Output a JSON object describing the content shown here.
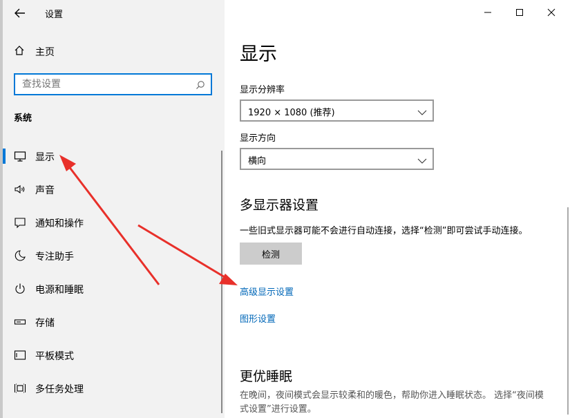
{
  "window": {
    "title": "设置"
  },
  "sidebar": {
    "home_label": "主页",
    "search_placeholder": "查找设置",
    "section_title": "系统",
    "items": [
      {
        "label": "显示",
        "icon": "monitor-icon",
        "active": true
      },
      {
        "label": "声音",
        "icon": "speaker-icon"
      },
      {
        "label": "通知和操作",
        "icon": "notification-icon"
      },
      {
        "label": "专注助手",
        "icon": "moon-icon"
      },
      {
        "label": "电源和睡眠",
        "icon": "power-icon"
      },
      {
        "label": "存储",
        "icon": "storage-icon"
      },
      {
        "label": "平板模式",
        "icon": "tablet-icon"
      },
      {
        "label": "多任务处理",
        "icon": "multitask-icon"
      }
    ]
  },
  "main": {
    "title": "显示",
    "resolution_label": "显示分辨率",
    "resolution_value": "1920 × 1080 (推荐)",
    "orientation_label": "显示方向",
    "orientation_value": "横向",
    "multi_display_heading": "多显示器设置",
    "multi_display_desc": "一些旧式显示器可能不会进行自动连接，选择“检测”即可尝试手动连接。",
    "detect_button": "检测",
    "advanced_link": "高级显示设置",
    "graphics_link": "图形设置",
    "sleep_heading": "更优睡眠",
    "sleep_desc": "在晚间，夜间模式会显示较柔和的暖色，帮助你进入睡眠状态。 选择“夜间模式设置”进行设置。"
  },
  "colors": {
    "accent": "#0078d7",
    "link": "#0067b8",
    "annotation_arrow": "#e8302a"
  }
}
